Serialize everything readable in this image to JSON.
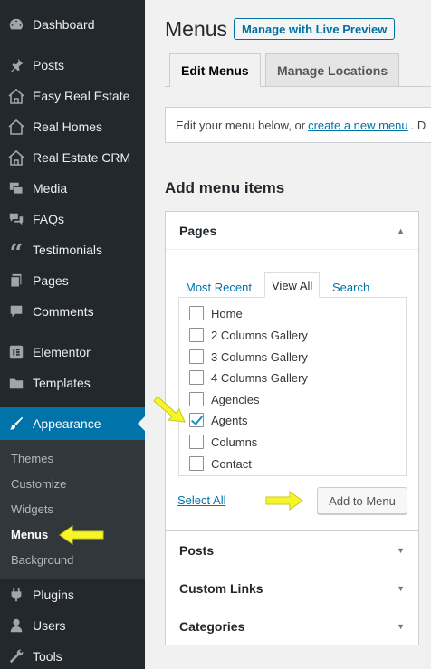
{
  "sidebar": {
    "items": [
      {
        "label": "Dashboard",
        "icon": "dashboard-icon"
      },
      {
        "label": "Posts",
        "icon": "pin-icon"
      },
      {
        "label": "Easy Real Estate",
        "icon": "house-icon"
      },
      {
        "label": "Real Homes",
        "icon": "house-icon"
      },
      {
        "label": "Real Estate CRM",
        "icon": "house-icon"
      },
      {
        "label": "Media",
        "icon": "media-icon"
      },
      {
        "label": "FAQs",
        "icon": "chat-icon"
      },
      {
        "label": "Testimonials",
        "icon": "quote-icon"
      },
      {
        "label": "Pages",
        "icon": "pages-icon"
      },
      {
        "label": "Comments",
        "icon": "comment-icon"
      },
      {
        "label": "Elementor",
        "icon": "elementor-icon"
      },
      {
        "label": "Templates",
        "icon": "folder-icon"
      },
      {
        "label": "Appearance",
        "icon": "brush-icon"
      },
      {
        "label": "Plugins",
        "icon": "plug-icon"
      },
      {
        "label": "Users",
        "icon": "user-icon"
      },
      {
        "label": "Tools",
        "icon": "wrench-icon"
      }
    ],
    "submenu": [
      "Themes",
      "Customize",
      "Widgets",
      "Menus",
      "Background"
    ],
    "active_color": "#0073aa"
  },
  "header": {
    "title": "Menus",
    "live_preview_label": "Manage with Live Preview"
  },
  "tabs": {
    "edit": "Edit Menus",
    "locations": "Manage Locations"
  },
  "notice": {
    "prefix": "Edit your menu below, or",
    "link": "create a new menu",
    "suffix": ". D"
  },
  "add_items_heading": "Add menu items",
  "pages_panel": {
    "title": "Pages",
    "tabs": {
      "recent": "Most Recent",
      "all": "View All",
      "search": "Search"
    },
    "pages": [
      {
        "label": "Home",
        "checked": false
      },
      {
        "label": "2 Columns Gallery",
        "checked": false
      },
      {
        "label": "3 Columns Gallery",
        "checked": false
      },
      {
        "label": "4 Columns Gallery",
        "checked": false
      },
      {
        "label": "Agencies",
        "checked": false
      },
      {
        "label": "Agents",
        "checked": true
      },
      {
        "label": "Columns",
        "checked": false
      },
      {
        "label": "Contact",
        "checked": false
      }
    ],
    "select_all": "Select All",
    "add_button": "Add to Menu"
  },
  "other_panels": {
    "posts": "Posts",
    "custom_links": "Custom Links",
    "categories": "Categories"
  },
  "annotation_color": "#f5f52a"
}
